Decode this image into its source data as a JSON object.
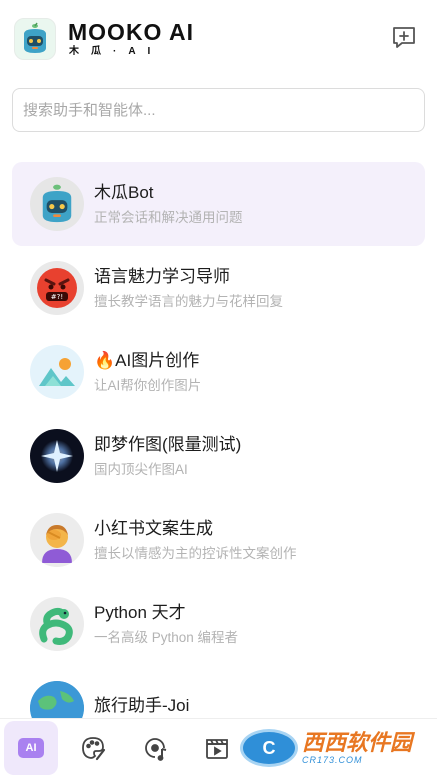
{
  "header": {
    "brand_name": "MOOKO AI",
    "brand_sub": "木瓜·AI"
  },
  "search": {
    "placeholder": "搜索助手和智能体..."
  },
  "assistants": [
    {
      "title": "木瓜Bot",
      "desc": "正常会话和解决通用问题",
      "icon": "mooko-robot-icon"
    },
    {
      "title": "语言魅力学习导师",
      "desc": "擅长教学语言的魅力与花样回复",
      "icon": "angry-face-icon"
    },
    {
      "title": "🔥AI图片创作",
      "desc": "让AI帮你创作图片",
      "icon": "image-landscape-icon"
    },
    {
      "title": "即梦作图(限量测试)",
      "desc": "国内顶尖作图AI",
      "icon": "sparkle-star-icon"
    },
    {
      "title": "小红书文案生成",
      "desc": "擅长以情感为主的控诉性文案创作",
      "icon": "facepalm-person-icon"
    },
    {
      "title": "Python 天才",
      "desc": "一名高级 Python 编程者",
      "icon": "python-snake-icon"
    },
    {
      "title": "旅行助手-Joi",
      "desc": "",
      "icon": "globe-icon"
    }
  ],
  "tabbar": {
    "ai_label": "AI",
    "tabs": [
      "ai-chat-icon",
      "palette-icon",
      "music-note-icon",
      "video-clapper-icon"
    ]
  },
  "watermark": {
    "main": "西西软件园",
    "sub": "CR173.COM"
  }
}
